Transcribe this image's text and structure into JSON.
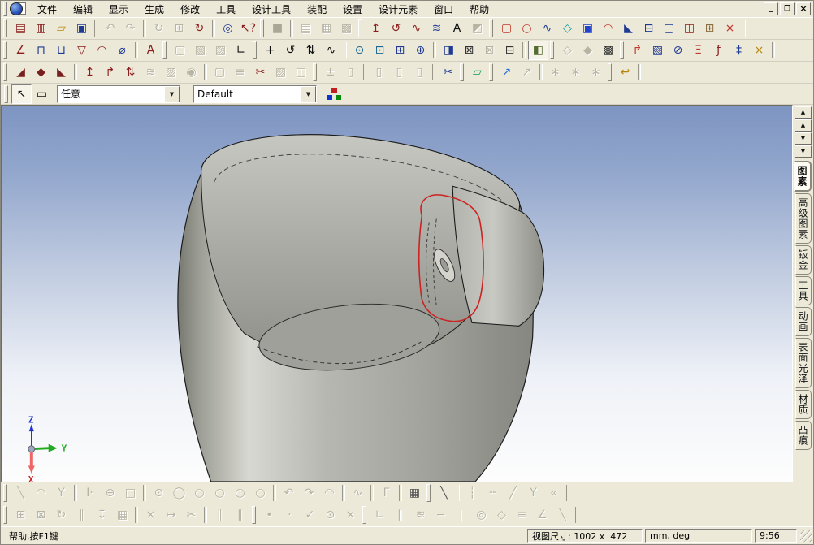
{
  "window": {
    "controls": [
      {
        "name": "minimize-button",
        "glyph": "_"
      },
      {
        "name": "restore-button",
        "glyph": "❐"
      },
      {
        "name": "close-button",
        "glyph": "×"
      }
    ]
  },
  "menu": {
    "items": [
      {
        "name": "menu-file",
        "label": "文件"
      },
      {
        "name": "menu-edit",
        "label": "编辑"
      },
      {
        "name": "menu-display",
        "label": "显示"
      },
      {
        "name": "menu-generate",
        "label": "生成"
      },
      {
        "name": "menu-modify",
        "label": "修改"
      },
      {
        "name": "menu-tools",
        "label": "工具"
      },
      {
        "name": "menu-design-tools",
        "label": "设计工具"
      },
      {
        "name": "menu-assembly",
        "label": "装配"
      },
      {
        "name": "menu-settings",
        "label": "设置"
      },
      {
        "name": "menu-design-elements",
        "label": "设计元素"
      },
      {
        "name": "menu-window",
        "label": "窗口"
      },
      {
        "name": "menu-help",
        "label": "帮助"
      }
    ]
  },
  "toolbars": {
    "row1": [
      "‖",
      {
        "n": "new-part-button",
        "g": "▤",
        "c": "#8b1d1d"
      },
      {
        "n": "new-drawing-button",
        "g": "▥",
        "c": "#8b1d1d"
      },
      {
        "n": "open-file-button",
        "g": "▱",
        "c": "#b8860b"
      },
      {
        "n": "save-button",
        "g": "▣",
        "c": "#1f3a93"
      },
      "|",
      {
        "n": "undo-button",
        "g": "↶",
        "en": false
      },
      {
        "n": "redo-button",
        "g": "↷",
        "en": false
      },
      "|",
      {
        "n": "regenerate-button",
        "g": "↻",
        "en": false
      },
      {
        "n": "copy-sheet-button",
        "g": "⊞",
        "en": false
      },
      {
        "n": "update-refs-button",
        "g": "↻",
        "c": "#8b1d1d"
      },
      "|",
      {
        "n": "design-tree-search-button",
        "g": "◎",
        "c": "#1f3a93"
      },
      {
        "n": "context-help-button",
        "g": "↖?",
        "c": "#8b1d1d"
      },
      "‖",
      {
        "n": "color-swatch-button",
        "g": "■",
        "c": "#aba797"
      },
      "|",
      {
        "n": "view-layout-1-button",
        "g": "▤",
        "en": false
      },
      {
        "n": "view-layout-2-button",
        "g": "▦",
        "en": false
      },
      {
        "n": "view-layout-3-button",
        "g": "▩",
        "en": false
      },
      "‖",
      {
        "n": "extrude-boss-button",
        "g": "↥",
        "c": "#8b1d1d"
      },
      {
        "n": "revolve-boss-button",
        "g": "↺",
        "c": "#8b1d1d"
      },
      {
        "n": "sweep-boss-button",
        "g": "∿",
        "c": "#8b1d1d"
      },
      {
        "n": "loft-boss-button",
        "g": "≋",
        "c": "#1f3a93"
      },
      {
        "n": "text-sketch-button",
        "g": "A",
        "c": "#111111"
      },
      {
        "n": "anchor-button",
        "g": "◩",
        "en": false
      },
      "‖",
      {
        "n": "extrude-cut-button",
        "g": "▢",
        "c": "#c0392b"
      },
      {
        "n": "revolve-cut-button",
        "g": "○",
        "c": "#c0392b"
      },
      {
        "n": "sweep-cut-button",
        "g": "∿",
        "c": "#1f3a93"
      },
      {
        "n": "loft-cut-button",
        "g": "◇",
        "c": "#00a0a0"
      },
      {
        "n": "fill-patch-button",
        "g": "▣",
        "c": "#2244cc"
      },
      {
        "n": "pipe-feature-button",
        "g": "◠",
        "c": "#c0392b"
      },
      {
        "n": "rib-feature-button",
        "g": "◣",
        "c": "#1f3a93"
      },
      {
        "n": "thin-feature-button",
        "g": "⊟",
        "c": "#1f3a93"
      },
      {
        "n": "shell-feature-button",
        "g": "▢",
        "c": "#1f3a93"
      },
      {
        "n": "mirror-feature-button",
        "g": "◫",
        "c": "#8b1d1d"
      },
      {
        "n": "array-feature-button",
        "g": "⊞",
        "c": "#8b6d3f"
      },
      {
        "n": "delete-face-button",
        "g": "×",
        "c": "#c0392b"
      },
      "|"
    ],
    "row2": [
      "‖",
      {
        "n": "sketch-fillet-button",
        "g": "∠",
        "c": "#8b1d1d"
      },
      {
        "n": "dim-horizontal-button",
        "g": "⊓",
        "c": "#1f3a93"
      },
      {
        "n": "dim-vertical-button",
        "g": "⊔",
        "c": "#1f3a93"
      },
      {
        "n": "profile-check-button",
        "g": "▽",
        "c": "#8b1d1d"
      },
      {
        "n": "corner-round-button",
        "g": "◠",
        "c": "#8b1d1d"
      },
      {
        "n": "dim-diameter-button",
        "g": "⌀",
        "c": "#1f3a93"
      },
      "|",
      {
        "n": "annotation-button",
        "g": "A",
        "c": "#8b1d1d"
      },
      "‖",
      {
        "n": "face-mode-1-button",
        "g": "▢",
        "en": false
      },
      {
        "n": "face-mode-2-button",
        "g": "▧",
        "en": false
      },
      {
        "n": "face-mode-3-button",
        "g": "▨",
        "en": false
      },
      {
        "n": "axis-display-button",
        "g": "∟",
        "c": "#111111"
      },
      "‖",
      {
        "n": "pan-view-button",
        "g": "+",
        "c": "#111111"
      },
      {
        "n": "rotate-view-button",
        "g": "↺",
        "c": "#111111"
      },
      {
        "n": "walk-view-button",
        "g": "⇅",
        "c": "#111111"
      },
      {
        "n": "spline-view-button",
        "g": "∿",
        "c": "#111111"
      },
      "|",
      {
        "n": "zoom-button",
        "g": "⊙",
        "c": "#1f6a93"
      },
      {
        "n": "zoom-window-button",
        "g": "⊡",
        "c": "#1f6a93"
      },
      {
        "n": "zoom-part-button",
        "g": "⊞",
        "c": "#1f3a93"
      },
      {
        "n": "zoom-target-button",
        "g": "⊕",
        "c": "#1f3a93"
      },
      "|",
      {
        "n": "prev-view-button",
        "g": "◨",
        "c": "#1f3a93"
      },
      {
        "n": "camera-view-button",
        "g": "⊠",
        "c": "#333333"
      },
      {
        "n": "camera-saved-button",
        "g": "⊠",
        "en": false
      },
      {
        "n": "view-list-button",
        "g": "⊟",
        "c": "#333333"
      },
      "|",
      {
        "n": "shaded-display-button",
        "g": "◧",
        "c": "#556b2f",
        "pr": true
      },
      "‖",
      {
        "n": "wireframe-display-button",
        "g": "◇",
        "en": false
      },
      {
        "n": "hidden-line-display-button",
        "g": "◆",
        "en": false
      },
      {
        "n": "render-display-button",
        "g": "▩",
        "c": "#333333"
      },
      "‖",
      {
        "n": "redline-button",
        "g": "↱",
        "c": "#c0392b"
      },
      {
        "n": "measure-button",
        "g": "▧",
        "c": "#1f3a93"
      },
      {
        "n": "section-view-button",
        "g": "⊘",
        "c": "#1f3a93"
      },
      {
        "n": "mass-properties-button",
        "g": "Ξ",
        "c": "#c0392b"
      },
      {
        "n": "parameters-button",
        "g": "ƒ",
        "c": "#8b1d1d"
      },
      {
        "n": "constraint-pin-button",
        "g": "‡",
        "c": "#1f3a93"
      },
      {
        "n": "suppress-button",
        "g": "×",
        "c": "#b8860b"
      },
      "|"
    ],
    "row3": [
      "‖",
      {
        "n": "paint-face-button",
        "g": "◢",
        "c": "#7a1f1f"
      },
      {
        "n": "paint-part-button",
        "g": "◆",
        "c": "#7a1f1f"
      },
      {
        "n": "paint-remove-button",
        "g": "◣",
        "c": "#7a1f1f"
      },
      "|",
      {
        "n": "sheet-extrude-button",
        "g": "↥",
        "c": "#8b1d1d"
      },
      {
        "n": "sheet-bend-button",
        "g": "↱",
        "c": "#8b1d1d"
      },
      {
        "n": "sheet-fold-button",
        "g": "⇅",
        "c": "#8b1d1d"
      },
      {
        "n": "sheet-unfold-button",
        "g": "≋",
        "en": false
      },
      {
        "n": "sheet-flatten-button",
        "g": "▨",
        "en": false
      },
      {
        "n": "sheet-corner-button",
        "g": "◉",
        "en": false
      },
      "|",
      {
        "n": "new-sheet-button",
        "g": "▢",
        "en": false
      },
      {
        "n": "stamp-tool-button",
        "g": "≡",
        "en": false
      },
      {
        "n": "cut-check-button",
        "g": "✂",
        "c": "#8b1d1d"
      },
      {
        "n": "sheet-copy-button",
        "g": "▨",
        "en": false
      },
      {
        "n": "sheet-mirror-button",
        "g": "◫",
        "en": false
      },
      "‖",
      {
        "n": "plus-block-button",
        "g": "±",
        "en": false
      },
      {
        "n": "block-button",
        "g": "▯",
        "en": false
      },
      "|",
      {
        "n": "block-group-1-button",
        "g": "▯",
        "en": false
      },
      {
        "n": "block-group-2-button",
        "g": "▯",
        "en": false
      },
      {
        "n": "block-group-3-button",
        "g": "▯",
        "en": false
      },
      "|",
      {
        "n": "verify-tool-button",
        "g": "✂",
        "c": "#1f3a93"
      },
      "‖",
      {
        "n": "sketch-plane-button",
        "g": "▱",
        "c": "#00a050"
      },
      "‖",
      {
        "n": "eyedropper-button",
        "g": "↗",
        "c": "#1f6ae0"
      },
      {
        "n": "eyedropper-apply-button",
        "g": "↗",
        "en": false
      },
      "|",
      {
        "n": "spray-1-button",
        "g": "∗",
        "en": false
      },
      {
        "n": "spray-2-button",
        "g": "∗",
        "en": false
      },
      {
        "n": "spray-3-button",
        "g": "∗",
        "en": false
      },
      "‖",
      {
        "n": "return-folder-button",
        "g": "↩",
        "c": "#b8860b"
      },
      "|"
    ],
    "pointer_row": [
      {
        "n": "select-pointer-button",
        "g": "↖",
        "c": "#111111",
        "pr": true
      },
      {
        "n": "select-box-button",
        "g": "▭",
        "c": "#111111"
      }
    ],
    "bottom1": [
      "‖",
      {
        "n": "line-2pt-button",
        "g": "╲",
        "en": false
      },
      {
        "n": "arc-tangent-button",
        "g": "◠",
        "en": false
      },
      {
        "n": "line-angle-button",
        "g": "Y",
        "en": false
      },
      "|",
      {
        "n": "input-coords-button",
        "g": "I·",
        "en": false
      },
      {
        "n": "grid-snap-button",
        "g": "⊕",
        "en": false
      },
      {
        "n": "rectangle-button",
        "g": "□",
        "en": false
      },
      "|",
      {
        "n": "circle-center-radius-button",
        "g": "⊙",
        "en": false
      },
      {
        "n": "circle-2pt-button",
        "g": "◯",
        "en": false
      },
      {
        "n": "circle-3pt-button",
        "g": "○",
        "en": false
      },
      {
        "n": "circle-tangent-1-button",
        "g": "○",
        "en": false
      },
      {
        "n": "circle-tangent-2-button",
        "g": "○",
        "en": false
      },
      {
        "n": "circle-tangent-3-button",
        "g": "○",
        "en": false
      },
      "|",
      {
        "n": "arc-center-button",
        "g": "↶",
        "en": false
      },
      {
        "n": "arc-3pt-button",
        "g": "↷",
        "en": false
      },
      {
        "n": "arc-endpoints-button",
        "g": "◠",
        "en": false
      },
      "|",
      {
        "n": "spline-button",
        "g": "∿",
        "en": false
      },
      "|",
      {
        "n": "corner-fillet-button",
        "g": "Γ",
        "en": false
      },
      "|",
      {
        "n": "projection-button",
        "g": "▦",
        "c": "#555555"
      },
      "‖",
      {
        "n": "construction-line-button",
        "g": "╲",
        "c": "#555555"
      },
      "|",
      {
        "n": "axis-line-button",
        "g": "┆",
        "en": false
      },
      {
        "n": "reference-line-button",
        "g": "╌",
        "en": false
      },
      {
        "n": "tangent-line-button",
        "g": "╱",
        "en": false
      },
      {
        "n": "bisector-line-button",
        "g": "Y",
        "en": false
      },
      {
        "n": "offset-curve-button",
        "g": "«",
        "en": false
      },
      "|"
    ],
    "bottom2": [
      "‖",
      {
        "n": "pattern-align-button",
        "g": "⊞",
        "en": false
      },
      {
        "n": "scale-sketch-button",
        "g": "⊠",
        "en": false
      },
      {
        "n": "rotate-sketch-button",
        "g": "↻",
        "en": false
      },
      {
        "n": "mirror-sketch-button",
        "g": "∥",
        "en": false
      },
      {
        "n": "move-sketch-button",
        "g": "↧",
        "en": false
      },
      {
        "n": "stamp-sketch-button",
        "g": "▦",
        "en": false
      },
      "|",
      {
        "n": "delete-segment-button",
        "g": "×",
        "en": false
      },
      {
        "n": "trim-to-point-button",
        "g": "↦",
        "en": false
      },
      {
        "n": "break-curve-button",
        "g": "✂",
        "en": false
      },
      "|",
      {
        "n": "offset-pattern-1-button",
        "g": "∥",
        "en": false
      },
      {
        "n": "offset-pattern-2-button",
        "g": "∥",
        "en": false
      },
      "‖",
      {
        "n": "point-button",
        "g": "•",
        "en": false
      },
      {
        "n": "point-on-curve-button",
        "g": "·",
        "en": false
      },
      {
        "n": "tangent-point-button",
        "g": "✓",
        "en": false
      },
      {
        "n": "circle-point-button",
        "g": "⊙",
        "en": false
      },
      {
        "n": "erase-point-button",
        "g": "×",
        "en": false
      },
      "‖",
      {
        "n": "constraint-perpendicular-button",
        "g": "∟",
        "en": false
      },
      {
        "n": "constraint-parallel-button",
        "g": "∥",
        "en": false
      },
      {
        "n": "constraint-symmetric-button",
        "g": "≋",
        "en": false
      },
      {
        "n": "constraint-horizontal-button",
        "g": "−",
        "en": false
      },
      {
        "n": "constraint-vertical-button",
        "g": "|",
        "en": false
      },
      {
        "n": "constraint-concentric-button",
        "g": "◎",
        "en": false
      },
      {
        "n": "constraint-tangent-button",
        "g": "◇",
        "en": false
      },
      {
        "n": "constraint-equal-button",
        "g": "≡",
        "en": false
      },
      {
        "n": "constraint-angle-button",
        "g": "∠",
        "en": false
      },
      {
        "n": "constraint-fix-button",
        "g": "╲",
        "en": false
      },
      "|"
    ]
  },
  "selection_bar": {
    "filter_value": "任意",
    "config_value": "Default",
    "dropdown_glyph": "▼"
  },
  "sidebar": {
    "scroll_buttons": [
      {
        "name": "scroll-top-button",
        "glyph": "▲"
      },
      {
        "name": "scroll-up-button",
        "glyph": "▲"
      },
      {
        "name": "scroll-down-button",
        "glyph": "▼"
      },
      {
        "name": "scroll-bottom-button",
        "glyph": "▼"
      }
    ],
    "tabs": [
      {
        "name": "tab-primitives",
        "label": "图素",
        "active": true
      },
      {
        "name": "tab-advanced-primitives",
        "label": "高级图素",
        "active": false
      },
      {
        "name": "tab-sheet-metal",
        "label": "钣金",
        "active": false
      },
      {
        "name": "tab-tools",
        "label": "工具",
        "active": false
      },
      {
        "name": "tab-animation",
        "label": "动画",
        "active": false
      },
      {
        "name": "tab-surface-finish",
        "label": "表面光泽",
        "active": false
      },
      {
        "name": "tab-material",
        "label": "材质",
        "active": false
      },
      {
        "name": "tab-emboss",
        "label": "凸痕",
        "active": false
      }
    ]
  },
  "viewport": {
    "axis_labels": {
      "x": "X",
      "y": "Y",
      "z": "Z"
    },
    "colors": {
      "sky_top": "#7e95c2",
      "sky_bottom": "#fdfdfd",
      "model_gray": "#b4b5af",
      "model_highlight": "#d8d8d2",
      "model_dark": "#8e8f88",
      "sketch_red": "#cc2222",
      "axis_x": "#dd3333",
      "axis_y": "#22aa22",
      "axis_z": "#2233cc"
    }
  },
  "status_bar": {
    "help": "帮助,按F1键",
    "view_size": "视图尺寸: 1002 x  472",
    "units": "mm, deg",
    "time": "9:56"
  }
}
